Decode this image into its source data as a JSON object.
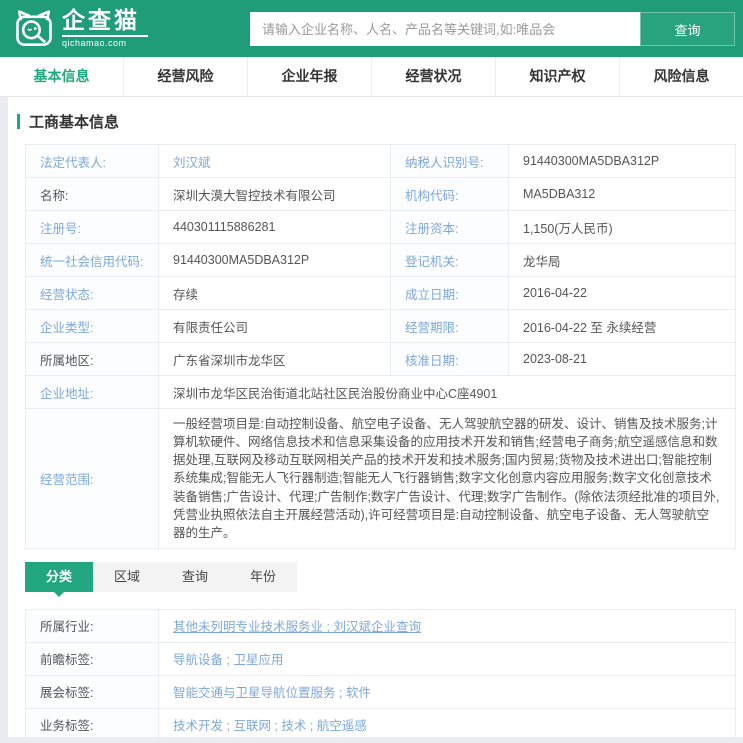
{
  "colors": {
    "header_green": "#1f9c78",
    "button_green": "#27a37d",
    "accent_green": "#22a67f",
    "link_blue": "#7fa8d8",
    "text_dark": "#555555"
  },
  "header": {
    "brand": {
      "name": "企查猫",
      "domain": "qichamao.com",
      "icon": "cat-magnifier-icon"
    },
    "search": {
      "placeholder": "请输入企业名称、人名、产品名等关键词,如:唯品会",
      "value": "",
      "button_label": "查询"
    }
  },
  "nav": {
    "tabs": [
      {
        "key": "basic-info",
        "label": "基本信息",
        "active": true
      },
      {
        "key": "business-risk",
        "label": "经营风险",
        "active": false
      },
      {
        "key": "annual-report",
        "label": "企业年报",
        "active": false
      },
      {
        "key": "operating-status",
        "label": "经营状况",
        "active": false
      },
      {
        "key": "intellectual-property",
        "label": "知识产权",
        "active": false
      },
      {
        "key": "risk-info",
        "label": "风险信息",
        "active": false
      }
    ]
  },
  "section": {
    "title": "工商基本信息"
  },
  "info_table": {
    "rows": [
      {
        "cells": [
          {
            "key": "legal-representative",
            "label": "法定代表人:",
            "label_blue": true,
            "value": "刘汉斌",
            "value_type": "link"
          },
          {
            "key": "taxpayer-id",
            "label": "纳税人识别号:",
            "label_blue": true,
            "value": "91440300MA5DBA312P"
          }
        ]
      },
      {
        "cells": [
          {
            "key": "company-name",
            "label": "名称:",
            "label_blue": false,
            "value": "深圳大漠大智控技术有限公司"
          },
          {
            "key": "organization-code",
            "label": "机构代码:",
            "label_blue": true,
            "value": "MA5DBA312"
          }
        ]
      },
      {
        "cells": [
          {
            "key": "registration-number",
            "label": "注册号:",
            "label_blue": true,
            "value": "440301115886281"
          },
          {
            "key": "registered-capital",
            "label": "注册资本:",
            "label_blue": true,
            "value": "1,150(万人民币)"
          }
        ]
      },
      {
        "cells": [
          {
            "key": "unified-social-credit-code",
            "label": "统一社会信用代码:",
            "label_blue": true,
            "value": "91440300MA5DBA312P"
          },
          {
            "key": "registration-authority",
            "label": "登记机关:",
            "label_blue": true,
            "value": "龙华局"
          }
        ]
      },
      {
        "cells": [
          {
            "key": "operating-state",
            "label": "经营状态:",
            "label_blue": true,
            "value": "存续"
          },
          {
            "key": "establish-date",
            "label": "成立日期:",
            "label_blue": true,
            "value": "2016-04-22"
          }
        ]
      },
      {
        "cells": [
          {
            "key": "company-type",
            "label": "企业类型:",
            "label_blue": true,
            "value": "有限责任公司"
          },
          {
            "key": "operating-period",
            "label": "经营期限:",
            "label_blue": true,
            "value": "2016-04-22 至 永续经营"
          }
        ]
      },
      {
        "cells": [
          {
            "key": "region",
            "label": "所属地区:",
            "label_blue": false,
            "value": "广东省深圳市龙华区"
          },
          {
            "key": "approval-date",
            "label": "核准日期:",
            "label_blue": true,
            "value": "2023-08-21"
          }
        ]
      },
      {
        "cells": [
          {
            "key": "company-address",
            "label": "企业地址:",
            "label_blue": true,
            "value": "深圳市龙华区民治街道北站社区民治股份商业中心C座4901",
            "span": true
          }
        ]
      },
      {
        "cells": [
          {
            "key": "business-scope",
            "label": "经营范围:",
            "label_blue": true,
            "value": "一般经营项目是:自动控制设备、航空电子设备、无人驾驶航空器的研发、设计、销售及技术服务;计算机软硬件、网络信息技术和信息采集设备的应用技术开发和销售;经营电子商务;航空遥感信息和数据处理,互联网及移动互联网相关产品的技术开发和技术服务;国内贸易;货物及技术进出口;智能控制系统集成;智能无人飞行器制造;智能无人飞行器销售;数字文化创意内容应用服务;数字文化创意技术装备销售;广告设计、代理;广告制作;数字广告设计、代理;数字广告制作。(除依法须经批准的项目外,凭营业执照依法自主开展经营活动),许可经营项目是:自动控制设备、航空电子设备、无人驾驶航空器的生产。",
            "span": true,
            "multiline": true
          }
        ]
      }
    ]
  },
  "sub_tabs": {
    "items": [
      {
        "key": "category",
        "label": "分类",
        "active": true
      },
      {
        "key": "region",
        "label": "区域",
        "active": false
      },
      {
        "key": "query",
        "label": "查询",
        "active": false
      },
      {
        "key": "year",
        "label": "年份",
        "active": false
      }
    ]
  },
  "tag_table": {
    "separator": " ; ",
    "rows": [
      {
        "key": "industry",
        "label": "所属行业:",
        "links": [
          "其他未列明专业技术服务业",
          "刘汉斌企业查询"
        ],
        "underline": true
      },
      {
        "key": "qianzhan-tags",
        "label": "前瞻标签:",
        "links": [
          "导航设备",
          "卫星应用"
        ],
        "underline": false
      },
      {
        "key": "exhibition-tags",
        "label": "展会标签:",
        "links": [
          "智能交通与卫星导航位置服务",
          "软件"
        ],
        "underline": false
      },
      {
        "key": "business-tags",
        "label": "业务标签:",
        "links": [
          "技术开发",
          "互联网",
          "技术",
          "航空遥感"
        ],
        "underline": false
      }
    ]
  }
}
